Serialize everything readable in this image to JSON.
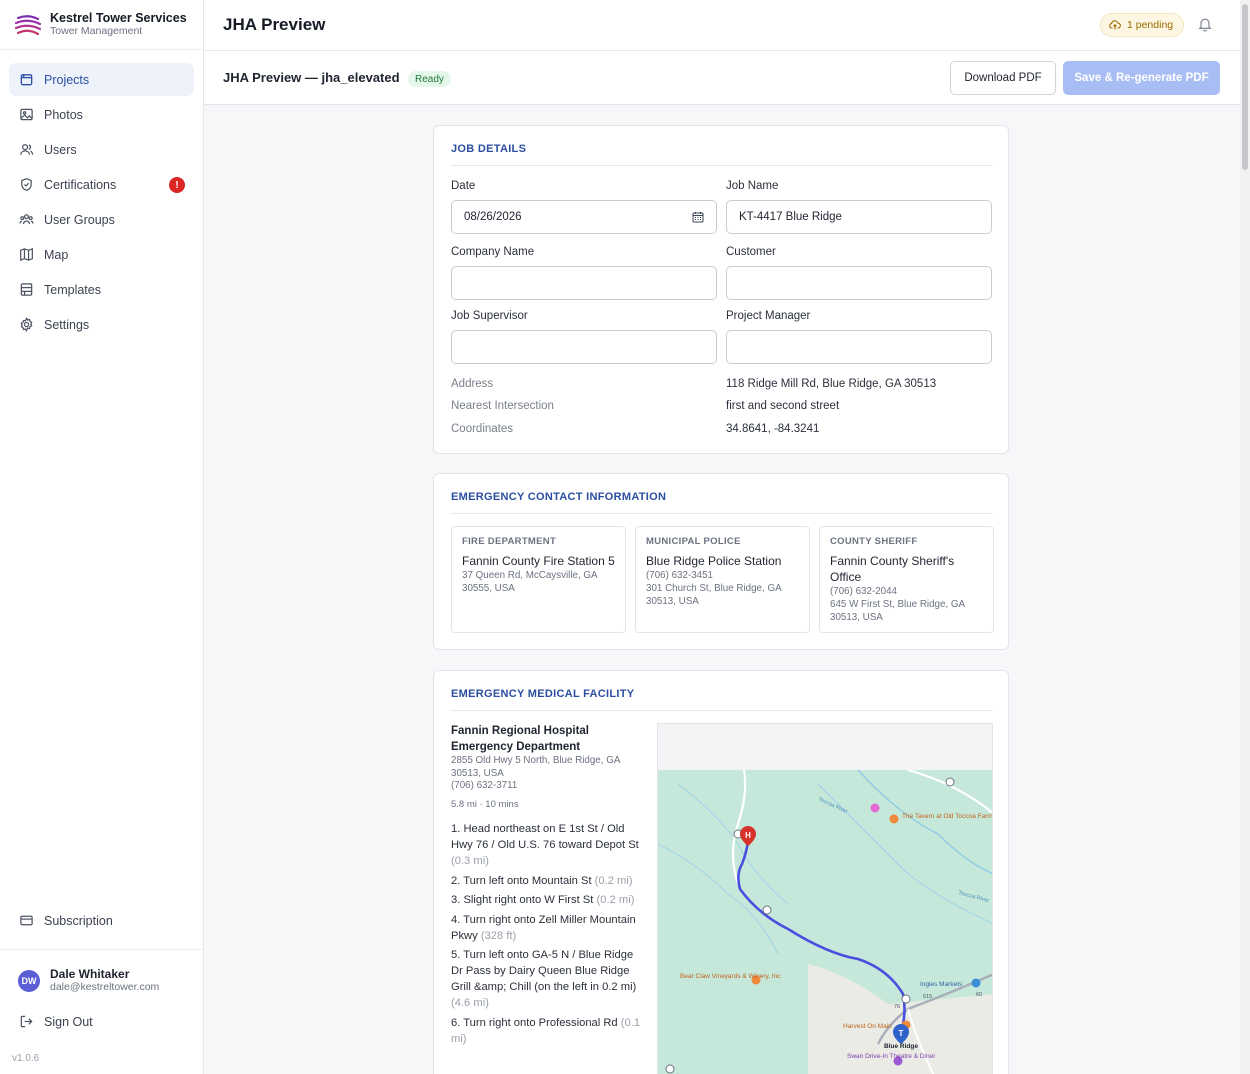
{
  "brand": {
    "name": "Kestrel Tower Services",
    "subtitle": "Tower Management"
  },
  "sidebar": {
    "items": [
      {
        "label": "Projects",
        "icon": "folder-icon"
      },
      {
        "label": "Photos",
        "icon": "image-icon"
      },
      {
        "label": "Users",
        "icon": "users-icon"
      },
      {
        "label": "Certifications",
        "icon": "shield-check-icon",
        "badge": "!"
      },
      {
        "label": "User Groups",
        "icon": "user-groups-icon"
      },
      {
        "label": "Map",
        "icon": "map-icon"
      },
      {
        "label": "Templates",
        "icon": "templates-icon"
      },
      {
        "label": "Settings",
        "icon": "gear-icon"
      }
    ],
    "subscription": "Subscription",
    "user": {
      "initials": "DW",
      "name": "Dale Whitaker",
      "email": "dale@kestreltower.com"
    },
    "signout": "Sign Out",
    "version": "v1.0.6"
  },
  "topbar": {
    "title": "JHA Preview",
    "pending": "1 pending"
  },
  "subheader": {
    "title": "JHA Preview — jha_elevated",
    "status": "Ready",
    "download": "Download PDF",
    "save": "Save & Re-generate PDF"
  },
  "job_details": {
    "title": "JOB DETAILS",
    "date_label": "Date",
    "date_value": "08/26/2026",
    "job_name_label": "Job Name",
    "job_name_value": "KT-4417 Blue Ridge",
    "company_label": "Company Name",
    "company_value": "",
    "customer_label": "Customer",
    "customer_value": "",
    "supervisor_label": "Job Supervisor",
    "supervisor_value": "",
    "pm_label": "Project Manager",
    "pm_value": "",
    "address_label": "Address",
    "address_value": "118 Ridge Mill Rd, Blue Ridge, GA 30513",
    "intersection_label": "Nearest Intersection",
    "intersection_value": "first and second street",
    "coords_label": "Coordinates",
    "coords_value": "34.8641, -84.3241"
  },
  "emergency": {
    "title": "EMERGENCY CONTACT INFORMATION",
    "contacts": [
      {
        "kind": "FIRE DEPARTMENT",
        "name": "Fannin County Fire Station 5",
        "phone": "",
        "address1": "37 Queen Rd, McCaysville, GA",
        "address2": "30555, USA"
      },
      {
        "kind": "MUNICIPAL POLICE",
        "name": "Blue Ridge Police Station",
        "phone": "(706) 632-3451",
        "address1": "301 Church St, Blue Ridge, GA",
        "address2": "30513, USA"
      },
      {
        "kind": "COUNTY SHERIFF",
        "name": "Fannin County Sheriff's Office",
        "phone": "(706) 632-2044",
        "address1": "645 W First St, Blue Ridge, GA",
        "address2": "30513, USA"
      }
    ]
  },
  "medical": {
    "title": "EMERGENCY MEDICAL FACILITY",
    "name": "Fannin Regional Hospital Emergency Department",
    "address1": "2855 Old Hwy 5 North, Blue Ridge, GA",
    "address2": "30513, USA",
    "phone": "(706) 632-3711",
    "distance": "5.8 mi · 10 mins",
    "steps": [
      {
        "text": "1. Head northeast on E 1st St / Old Hwy 76 / Old U.S. 76 toward Depot St",
        "dist": "(0.3 mi)"
      },
      {
        "text": "2. Turn left onto Mountain St",
        "dist": "(0.2 mi)"
      },
      {
        "text": "3. Slight right onto W First St",
        "dist": "(0.2 mi)"
      },
      {
        "text": "4. Turn right onto Zell Miller Mountain Pkwy",
        "dist": "(328 ft)"
      },
      {
        "text": "5. Turn left onto GA-5 N / Blue Ridge Dr Pass by Dairy Queen Blue Ridge Grill &amp; Chill (on the left in 0.2 mi)",
        "dist": "(4.6 mi)"
      },
      {
        "text": "6. Turn right onto Professional Rd",
        "dist": "(0.1 mi)"
      }
    ],
    "map": {
      "labels": {
        "tavern": "The Tavern at Old Toccoa Farm",
        "bearclaw": "Bear Claw Vineyards & Winery, Inc",
        "ingles": "Ingles Markets",
        "harvest": "Harvest On Main",
        "blueridge": "Blue Ridge",
        "swan": "Swan Drive-In Theatre & Diner",
        "river1": "Toccoa River",
        "river2": "Toccoa River",
        "marker_h": "H",
        "marker_t": "T",
        "shield76": "76",
        "shield515": "515",
        "shield60": "60"
      }
    }
  },
  "colors": {
    "accent": "#2b4ea2",
    "route": "#4a4fe0",
    "marker_h": "#d6312b",
    "marker_t": "#2f63c9",
    "map_bg": "#c6e8da"
  }
}
